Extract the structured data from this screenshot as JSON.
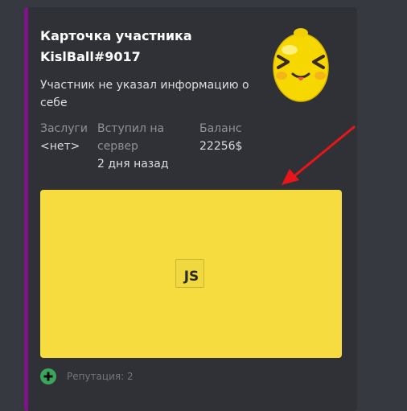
{
  "embed": {
    "title": "Карточка участника KislBall#9017",
    "description": "Участник не указал информацию о себе",
    "fields": [
      {
        "name": "Заслуги",
        "value": "<нет>"
      },
      {
        "name": "Вступил на сервер",
        "value": "2 дня назад"
      },
      {
        "name": "Баланс",
        "value": "22256$"
      }
    ],
    "image": {
      "icon_label": "JS",
      "icon": "javascript-file-icon"
    },
    "footer": {
      "text": "Репутация: 2",
      "icon": "plus-circle-icon"
    },
    "thumbnail": "lemon-emoji"
  },
  "colors": {
    "background": "#36393f",
    "embed_background": "#2f3136",
    "embed_border": "#7d1589",
    "image_background": "#f7dc3f",
    "footer_icon": "#3ba55c",
    "arrow": "#e8151a"
  }
}
